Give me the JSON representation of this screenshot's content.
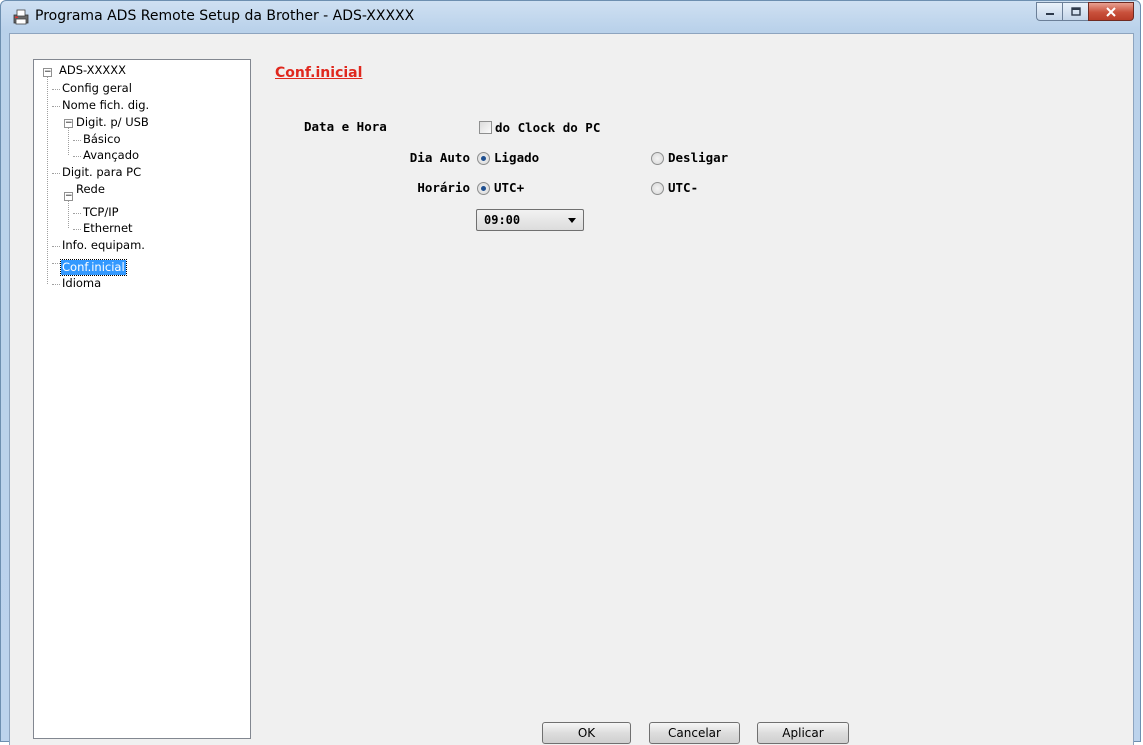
{
  "window": {
    "title": "Programa ADS Remote Setup da Brother - ADS-XXXXX",
    "icon": "printer-app-icon",
    "controls": {
      "minimize": "minimize-icon",
      "maximize": "maximize-icon",
      "close": "close-icon"
    }
  },
  "tree": {
    "root": "ADS-XXXXX",
    "items": [
      {
        "label": "Config geral",
        "level": 1
      },
      {
        "label": "Nome fich. dig.",
        "level": 1
      },
      {
        "label": "Digit. p/ USB",
        "level": 1,
        "expanded": true
      },
      {
        "label": "Básico",
        "level": 2
      },
      {
        "label": "Avançado",
        "level": 2
      },
      {
        "label": "Digit. para PC",
        "level": 1
      },
      {
        "label": "Rede",
        "level": 1,
        "expanded": true
      },
      {
        "label": "TCP/IP",
        "level": 2
      },
      {
        "label": "Ethernet",
        "level": 2
      },
      {
        "label": "Info. equipam.",
        "level": 1
      },
      {
        "label": "Conf.inicial",
        "level": 1,
        "selected": true
      },
      {
        "label": "Idioma",
        "level": 1
      }
    ]
  },
  "panel": {
    "title": "Conf.inicial",
    "date_time_label": "Data e Hora",
    "pc_clock_checkbox": {
      "label": "do Clock do PC",
      "checked": false
    },
    "auto_day": {
      "label": "Dia Auto",
      "options": [
        {
          "label": "Ligado",
          "checked": true
        },
        {
          "label": "Desligar",
          "checked": false
        }
      ]
    },
    "timezone": {
      "label": "Horário",
      "options": [
        {
          "label": "UTC+",
          "checked": true
        },
        {
          "label": "UTC-",
          "checked": false
        }
      ],
      "offset_value": "09:00"
    }
  },
  "buttons": {
    "ok": "OK",
    "cancel": "Cancelar",
    "apply": "Aplicar"
  },
  "colors": {
    "section_title": "#e0281e",
    "selection": "#3399ff"
  }
}
